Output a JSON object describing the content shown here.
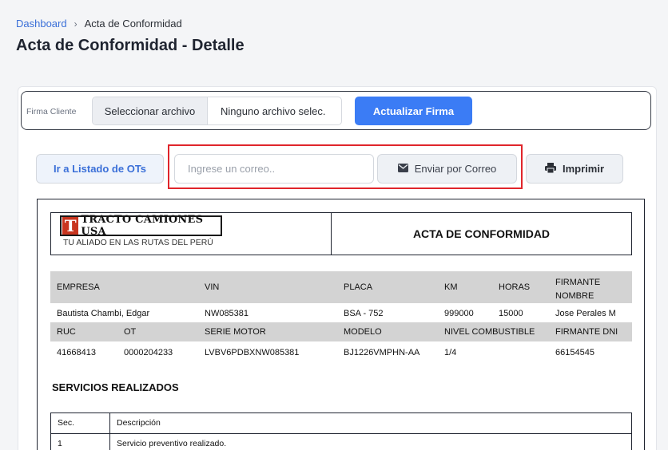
{
  "breadcrumb": {
    "home": "Dashboard",
    "separator": "›",
    "current": "Acta de Conformidad"
  },
  "page_title": "Acta de Conformidad - Detalle",
  "firma": {
    "label": "Firma Cliente",
    "file_button": "Seleccionar archivo",
    "file_name": "Ninguno archivo selec.",
    "update_button": "Actualizar Firma"
  },
  "actions": {
    "list_button": "Ir a Listado de OTs",
    "email_placeholder": "Ingrese un correo..",
    "send_button": "Enviar por Correo",
    "print_button": "Imprimir"
  },
  "document": {
    "logo": {
      "letter": "T",
      "name": "TRACTO CAMIONES USA",
      "tagline": "TU ALIADO EN LAS RUTAS DEL PERÚ"
    },
    "title": "ACTA DE CONFORMIDAD",
    "headers1": {
      "empresa": "EMPRESA",
      "vin": "VIN",
      "placa": "PLACA",
      "km": "KM",
      "horas": "HORAS",
      "firmante_nombre": "FIRMANTE NOMBRE"
    },
    "values1": {
      "empresa": "Bautista Chambi, Edgar",
      "vin": "NW085381",
      "placa": "BSA - 752",
      "km": "999000",
      "horas": "15000",
      "firmante_nombre": "Jose Perales M"
    },
    "headers2": {
      "ruc": "RUC",
      "ot": "OT",
      "serie_motor": "SERIE MOTOR",
      "modelo": "MODELO",
      "nivel_combustible": "NIVEL COMBUSTIBLE",
      "firmante_dni": "FIRMANTE DNI"
    },
    "values2": {
      "ruc": "41668413",
      "ot": "0000204233",
      "serie_motor": "LVBV6PDBXNW085381",
      "modelo": "BJ1226VMPHN-AA",
      "nivel_combustible": "1/4",
      "firmante_dni": "66154545"
    },
    "services_title": "SERVICIOS REALIZADOS",
    "services_headers": {
      "sec": "Sec.",
      "desc": "Descripción"
    },
    "services": [
      {
        "sec": "1",
        "desc": "Servicio preventivo realizado."
      }
    ]
  }
}
